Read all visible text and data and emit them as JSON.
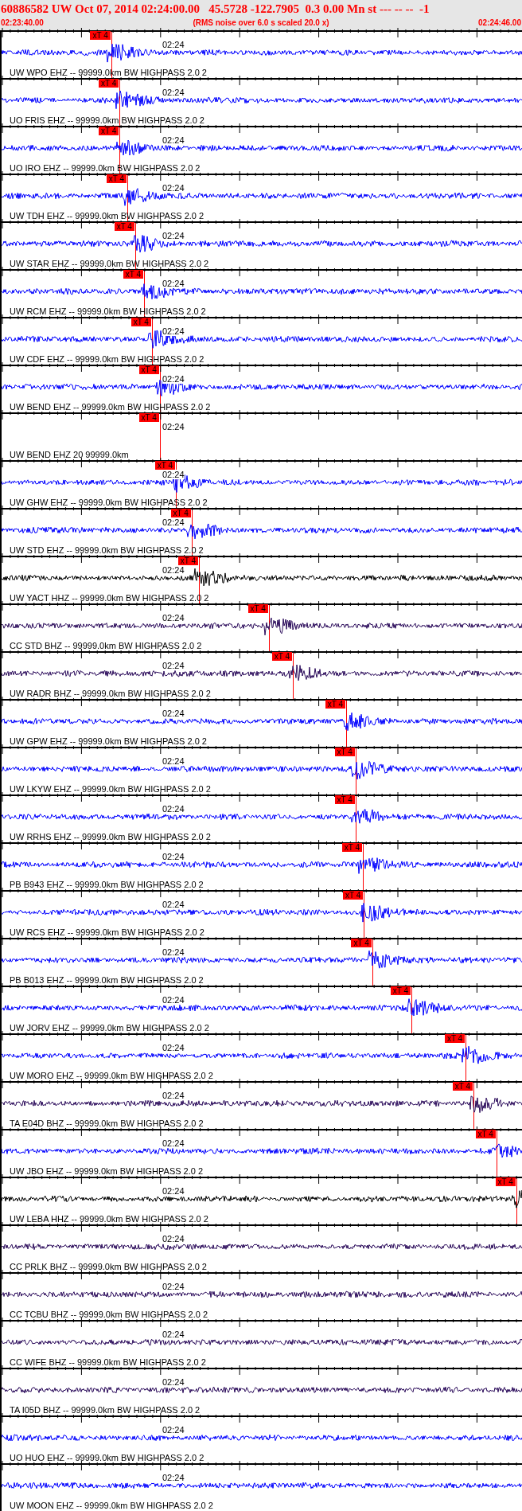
{
  "header": {
    "title": "60886582 UW Oct 07, 2014 02:24:00.00   45.5728 -122.7905  0.3 0.00 Mn st --- -- --  -1",
    "start_time": "02:23:40.00",
    "note": "(RMS noise over 6.0 s scaled 20.0 x)",
    "end_time": "02:24:46.00"
  },
  "traces": [
    {
      "label": "UW WPO EHZ -- 99999.0km BW HIGHPASS 2.0 2",
      "time_label": "02:24",
      "color": "#0000ff",
      "kind": "waveform",
      "pick": {
        "label": "xT 4",
        "level": 0.21
      }
    },
    {
      "label": "UO FRIS EHZ -- 99999.0km BW HIGHPASS 2.0 2",
      "time_label": "02:24",
      "color": "#0000ff",
      "kind": "waveform",
      "pick": {
        "label": "xT 4",
        "level": 0.226
      }
    },
    {
      "label": "UO IRO EHZ -- 99999.0km BW HIGHPASS 2.0 2",
      "time_label": "02:24",
      "color": "#0000ff",
      "kind": "waveform",
      "pick": {
        "label": "xT 4",
        "level": 0.226
      }
    },
    {
      "label": "UW TDH EHZ -- 99999.0km BW HIGHPASS 2.0 2",
      "time_label": "02:24",
      "color": "#0000ff",
      "kind": "waveform",
      "pick": {
        "label": "xT 4",
        "level": 0.241
      }
    },
    {
      "label": "UW STAR EHZ -- 99999.0km BW HIGHPASS 2.0 2",
      "time_label": "02:24",
      "color": "#0000ff",
      "kind": "waveform",
      "pick": {
        "label": "xT 4",
        "level": 0.256
      }
    },
    {
      "label": "UW RCM EHZ -- 99999.0km BW HIGHPASS 2.0 2",
      "time_label": "02:24",
      "color": "#0000ff",
      "kind": "waveform",
      "pick": {
        "label": "xT 4",
        "level": 0.273
      }
    },
    {
      "label": "UW CDF EHZ -- 99999.0km BW HIGHPASS 2.0 2",
      "time_label": "02:24",
      "color": "#0000ff",
      "kind": "waveform",
      "pick": {
        "label": "xT 4",
        "level": 0.288
      }
    },
    {
      "label": "UW BEND EHZ -- 99999.0km BW HIGHPASS 2.0 2",
      "time_label": "02:24",
      "color": "#0000ff",
      "kind": "waveform",
      "pick": {
        "label": "xT 4",
        "level": 0.303
      }
    },
    {
      "label": "UW BEND EHZ 20 99999.0km",
      "time_label": "02:24",
      "kind": "empty",
      "pick": {
        "label": "xT 4",
        "level": 0.303
      }
    },
    {
      "label": "UW GHW EHZ -- 99999.0km BW HIGHPASS 2.0 2",
      "time_label": "02:24",
      "color": "#0000ff",
      "kind": "waveform",
      "pick": {
        "label": "xT 4",
        "level": 0.334
      }
    },
    {
      "label": "UW STD EHZ -- 99999.0km BW HIGHPASS 2.0 2",
      "time_label": "02:24",
      "color": "#0000ff",
      "kind": "waveform",
      "pick": {
        "label": "xT 4",
        "level": 0.364
      }
    },
    {
      "label": "UW YACT HHZ -- 99999.0km BW HIGHPASS 2.0 2",
      "time_label": "02:24",
      "color": "#000000",
      "kind": "waveform",
      "pick": {
        "label": "xT 4",
        "level": 0.378
      }
    },
    {
      "label": "CC STD BHZ -- 99999.0km BW HIGHPASS 2.0 2",
      "time_label": "02:24",
      "color": "#2a0a5a",
      "kind": "waveform",
      "pick": {
        "label": "xT 4",
        "level": 0.512
      }
    },
    {
      "label": "UW RADR BHZ -- 99999.0km BW HIGHPASS 2.0 2",
      "time_label": "02:24",
      "color": "#2a0a5a",
      "kind": "waveform",
      "pick": {
        "label": "xT 4",
        "level": 0.558
      }
    },
    {
      "label": "UW GPW EHZ -- 99999.0km BW HIGHPASS 2.0 2",
      "time_label": "02:24",
      "color": "#0000ff",
      "kind": "waveform",
      "pick": {
        "label": "xT 4",
        "level": 0.66
      }
    },
    {
      "label": "UW LKYW EHZ -- 99999.0km BW HIGHPASS 2.0 2",
      "time_label": "02:24",
      "color": "#0000ff",
      "kind": "waveform",
      "pick": {
        "label": "xT 4",
        "level": 0.678
      }
    },
    {
      "label": "UW RRHS EHZ -- 99999.0km BW HIGHPASS 2.0 2",
      "time_label": "02:24",
      "color": "#0000ff",
      "kind": "waveform",
      "pick": {
        "label": "xT 4",
        "level": 0.678
      }
    },
    {
      "label": "PB B943 EHZ -- 99999.0km BW HIGHPASS 2.0 2",
      "time_label": "02:24",
      "color": "#0000ff",
      "kind": "waveform",
      "pick": {
        "label": "xT 4",
        "level": 0.692
      }
    },
    {
      "label": "UW RCS EHZ -- 99999.0km BW HIGHPASS 2.0 2",
      "time_label": "02:24",
      "color": "#0000ff",
      "kind": "waveform",
      "pick": {
        "label": "xT 4",
        "level": 0.694
      }
    },
    {
      "label": "PB B013 EHZ -- 99999.0km BW HIGHPASS 2.0 2",
      "time_label": "02:24",
      "color": "#0000ff",
      "kind": "waveform",
      "pick": {
        "label": "xT 4",
        "level": 0.71
      }
    },
    {
      "label": "UW JORV EHZ -- 99999.0km BW HIGHPASS 2.0 2",
      "time_label": "02:24",
      "color": "#0000ff",
      "kind": "waveform",
      "pick": {
        "label": "xT 4",
        "level": 0.785
      }
    },
    {
      "label": "UW MORO EHZ -- 99999.0km BW HIGHPASS 2.0 2",
      "time_label": "02:24",
      "color": "#0000ff",
      "kind": "waveform",
      "pick": {
        "label": "xT 4",
        "level": 0.889
      }
    },
    {
      "label": "TA E04D BHZ -- 99999.0km BW HIGHPASS 2.0 2",
      "time_label": "02:24",
      "color": "#2a0a5a",
      "kind": "waveform",
      "pick": {
        "label": "xT 4",
        "level": 0.904
      }
    },
    {
      "label": "UW JBO EHZ -- 99999.0km BW HIGHPASS 2.0 2",
      "time_label": "02:24",
      "color": "#0000ff",
      "kind": "waveform",
      "pick": {
        "label": "xT 4",
        "level": 0.948
      }
    },
    {
      "label": "UW LEBA HHZ -- 99999.0km BW HIGHPASS 2.0 2",
      "time_label": "02:24",
      "color": "#000000",
      "kind": "waveform",
      "pick": {
        "label": "xT 4",
        "level": 0.986
      }
    },
    {
      "label": "CC PRLK BHZ -- 99999.0km BW HIGHPASS 2.0 2",
      "time_label": "02:24",
      "color": "#2a0a5a",
      "kind": "waveform"
    },
    {
      "label": "CC TCBU BHZ -- 99999.0km BW HIGHPASS 2.0 2",
      "time_label": "02:24",
      "color": "#2a0a5a",
      "kind": "waveform"
    },
    {
      "label": "CC WIFE BHZ -- 99999.0km BW HIGHPASS 2.0 2",
      "time_label": "02:24",
      "color": "#2a0a5a",
      "kind": "waveform"
    },
    {
      "label": "TA I05D BHZ -- 99999.0km BW HIGHPASS 2.0 2",
      "time_label": "02:24",
      "color": "#2a0a5a",
      "kind": "waveform"
    },
    {
      "label": "UO HUO EHZ -- 99999.0km BW HIGHPASS 2.0 2",
      "time_label": "02:24",
      "color": "#0000ff",
      "kind": "waveform"
    },
    {
      "label": "UW MOON EHZ -- 99999.0km BW HIGHPASS 2.0 2",
      "time_label": "02:24",
      "color": "#0000ff",
      "kind": "waveform"
    }
  ]
}
